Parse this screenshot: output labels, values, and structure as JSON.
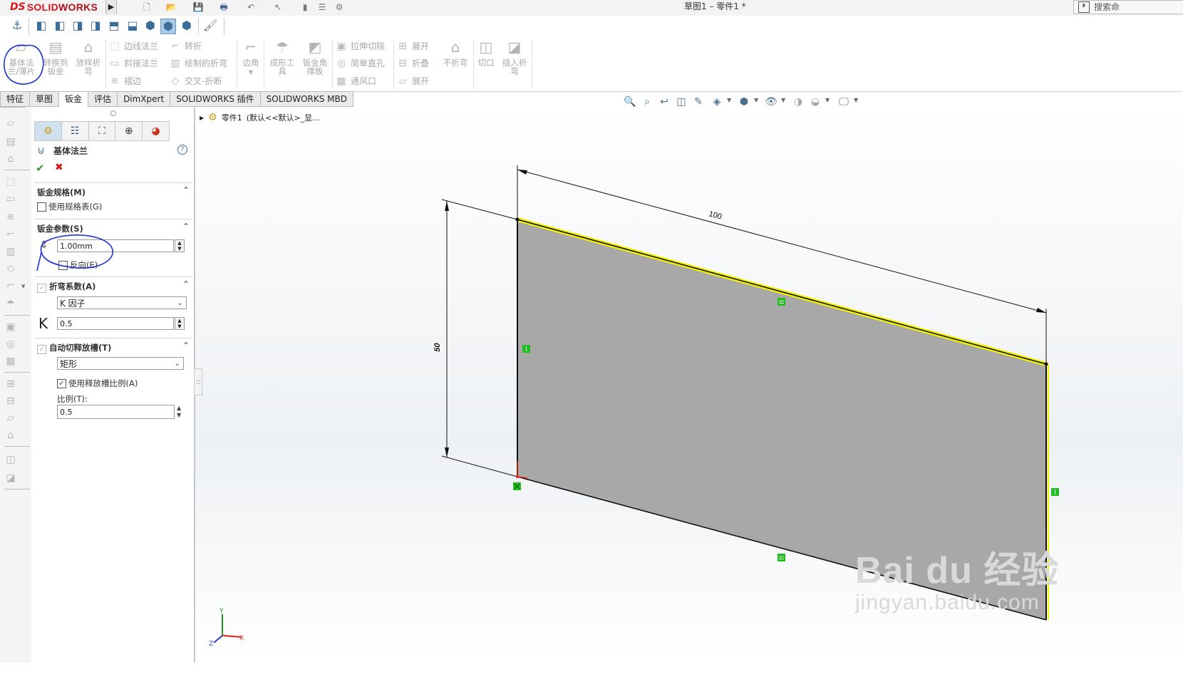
{
  "titlebar": {
    "brand_ds": "DS",
    "brand_solid": "SOLID",
    "brand_works": "WORKS",
    "doc_title": "草图1 – 零件1 *",
    "search_label": "搜索命"
  },
  "commands": {
    "base_flange": "基体法兰/薄片",
    "base_flange_l1": "基体法",
    "base_flange_l2": "兰/薄片",
    "convert_l1": "转换到",
    "convert_l2": "钣金",
    "lofted_l1": "放样折",
    "lofted_l2": "弯",
    "edge_flange": "边线法兰",
    "miter_flange": "斜接法兰",
    "hem": "褶边",
    "jog": "转折",
    "sketched_bend": "绘制的折弯",
    "cross_break": "交叉-折断",
    "corner": "边角",
    "forming_l1": "成形工",
    "forming_l2": "具",
    "gusset_l1": "钣金角",
    "gusset_l2": "撑板",
    "extruded_cut": "拉伸切除",
    "simple_hole": "简单直孔",
    "vent": "通风口",
    "unfold": "展开",
    "fold": "折叠",
    "flatten": "展开",
    "no_bends": "不折弯",
    "rip": "切口",
    "insert_bends_l1": "插入折",
    "insert_bends_l2": "弯"
  },
  "tabs": [
    "特征",
    "草图",
    "钣金",
    "评估",
    "DimXpert",
    "SOLIDWORKS 插件",
    "SOLIDWORKS MBD"
  ],
  "active_tab": "钣金",
  "tree": {
    "part": "零件1",
    "config": "(默认<<默认>_显..."
  },
  "property_manager": {
    "title": "基体法兰",
    "help": "?",
    "ok": "✔",
    "cancel": "✖",
    "gauge": {
      "header": "钣金规格(M)",
      "use_gauge_table": "使用规格表(G)",
      "use_gauge_checked": false
    },
    "params": {
      "header": "钣金参数(S)",
      "thickness": "1.00mm",
      "reverse": "反向(E)",
      "reverse_checked": false
    },
    "bend_allowance": {
      "header": "折弯系数(A)",
      "type": "K 因子",
      "k_label": "K",
      "k_value": "0.5"
    },
    "auto_relief": {
      "header": "自动切释放槽(T)",
      "type": "矩形",
      "use_ratio": "使用释放槽比例(A)",
      "use_ratio_checked": true,
      "ratio_label": "比例(T):",
      "ratio_value": "0.5"
    }
  },
  "sketch": {
    "dim_width": "100",
    "dim_height": "50",
    "colors": {
      "face": "#a8a8a8",
      "highlight": "#f4f400",
      "relation": "#1fbf1f",
      "dimension": "#111111"
    }
  },
  "triad": {
    "x": "X",
    "y": "Y",
    "z": "Z"
  },
  "watermark": {
    "main": "Bai du 经验",
    "sub": "jingyan.baidu.com"
  }
}
